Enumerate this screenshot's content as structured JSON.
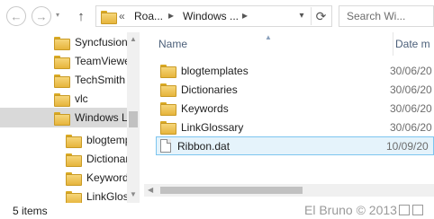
{
  "address": {
    "overflow": "«",
    "crumbs": [
      "Roa...",
      "Windows ..."
    ],
    "separator": "▸",
    "dropdown": "▾",
    "refresh_glyph": "⟳"
  },
  "nav": {
    "back_glyph": "←",
    "forward_glyph": "→",
    "history_glyph": "▾",
    "up_glyph": "↑"
  },
  "search": {
    "placeholder": "Search Wi..."
  },
  "tree": {
    "items": [
      {
        "label": "Syncfusion"
      },
      {
        "label": "TeamViewe"
      },
      {
        "label": "TechSmith"
      },
      {
        "label": "vlc"
      },
      {
        "label": "Windows L"
      },
      {
        "label": "blogtemp"
      },
      {
        "label": "Dictionar"
      },
      {
        "label": "Keywords"
      },
      {
        "label": "LinkGloss"
      }
    ]
  },
  "columns": {
    "name": "Name",
    "date": "Date m"
  },
  "files": [
    {
      "name": "blogtemplates",
      "date": "30/06/20",
      "type": "folder"
    },
    {
      "name": "Dictionaries",
      "date": "30/06/20",
      "type": "folder"
    },
    {
      "name": "Keywords",
      "date": "30/06/20",
      "type": "folder"
    },
    {
      "name": "LinkGlossary",
      "date": "30/06/20",
      "type": "folder"
    },
    {
      "name": "Ribbon.dat",
      "date": "10/09/20",
      "type": "file"
    }
  ],
  "status": {
    "count": "5 items",
    "watermark": "El Bruno © 2013"
  },
  "colors": {
    "selection": "#e5f3fb",
    "selection_border": "#7dc5ef",
    "header_text": "#4c607a"
  }
}
